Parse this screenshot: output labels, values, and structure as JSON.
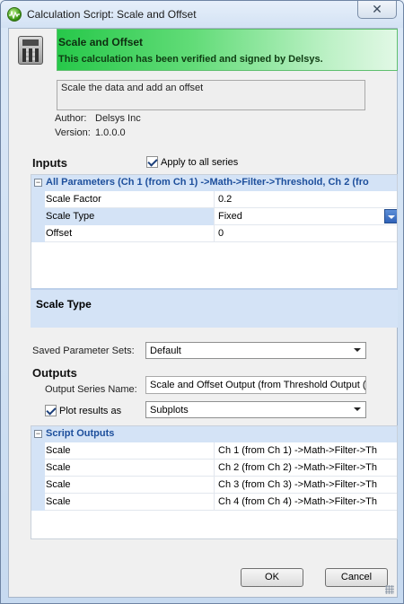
{
  "window": {
    "title": "Calculation Script: Scale and Offset",
    "close_glyph": "✕"
  },
  "header": {
    "title": "Scale and Offset",
    "subtitle": "This calculation has been verified and signed by Delsys.",
    "description": "Scale the data and add an offset",
    "author_label": "Author:",
    "author": "Delsys Inc",
    "version_label": "Version:",
    "version": "1.0.0.0",
    "icon": "calculator-icon",
    "banner_color": "#27c84a"
  },
  "inputs": {
    "heading": "Inputs",
    "apply_all_label": "Apply to all series",
    "apply_all_checked": true,
    "group_label": "All Parameters (Ch 1 (from Ch 1) ->Math->Filter->Threshold, Ch 2 (fro",
    "rows": [
      {
        "name": "Scale Factor",
        "value": "0.2"
      },
      {
        "name": "Scale Type",
        "value": "Fixed"
      },
      {
        "name": "Offset",
        "value": "0"
      }
    ],
    "help_title": "Scale Type"
  },
  "saved_sets": {
    "label": "Saved Parameter Sets:",
    "value": "Default"
  },
  "outputs": {
    "heading": "Outputs",
    "series_name_label": "Output Series Name:",
    "series_name_value": "Scale and Offset Output (from Threshold Output (",
    "plot_label": "Plot results as",
    "plot_checked": true,
    "plot_value": "Subplots",
    "group_label": "Script Outputs",
    "rows": [
      {
        "name": "Scale",
        "value": "Ch 1 (from Ch 1) ->Math->Filter->Th"
      },
      {
        "name": "Scale",
        "value": "Ch 2 (from Ch 2) ->Math->Filter->Th"
      },
      {
        "name": "Scale",
        "value": "Ch 3 (from Ch 3) ->Math->Filter->Th"
      },
      {
        "name": "Scale",
        "value": "Ch 4 (from Ch 4) ->Math->Filter->Th"
      }
    ]
  },
  "buttons": {
    "ok": "OK",
    "cancel": "Cancel"
  }
}
